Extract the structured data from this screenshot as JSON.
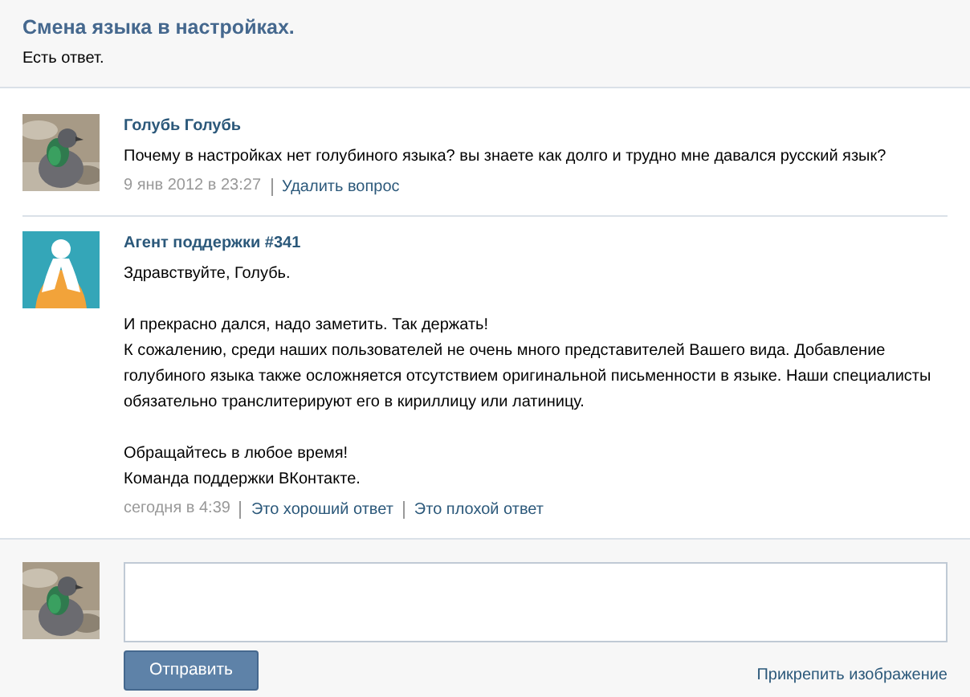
{
  "header": {
    "title": "Смена языка в настройках.",
    "status": "Есть ответ."
  },
  "posts": [
    {
      "kind": "question",
      "author": "Голубь Голубь",
      "paragraphs": [
        [
          "Почему в настройках нет голубиного языка? вы знаете как долго и трудно мне давался русский язык?"
        ]
      ],
      "time": "9 янв 2012 в 23:27",
      "links": [
        "Удалить вопрос"
      ]
    },
    {
      "kind": "answer",
      "author": "Агент поддержки #341",
      "paragraphs": [
        [
          "Здравствуйте, Голубь."
        ],
        [
          "И прекрасно дался, надо заметить. Так держать!",
          "К сожалению, среди наших пользователей не очень много представителей Вашего вида. Добавление голубиного языка также осложняется отсутствием оригинальной письменности в языке. Наши специалисты обязательно транслитерируют его в кириллицу или латиницу."
        ],
        [
          "Обращайтесь в любое время!",
          "Команда поддержки ВКонтакте."
        ]
      ],
      "time": "сегодня в 4:39",
      "links": [
        "Это хороший ответ",
        "Это плохой ответ"
      ]
    }
  ],
  "composer": {
    "button": "Отправить",
    "link": "Прикрепить изображение"
  }
}
